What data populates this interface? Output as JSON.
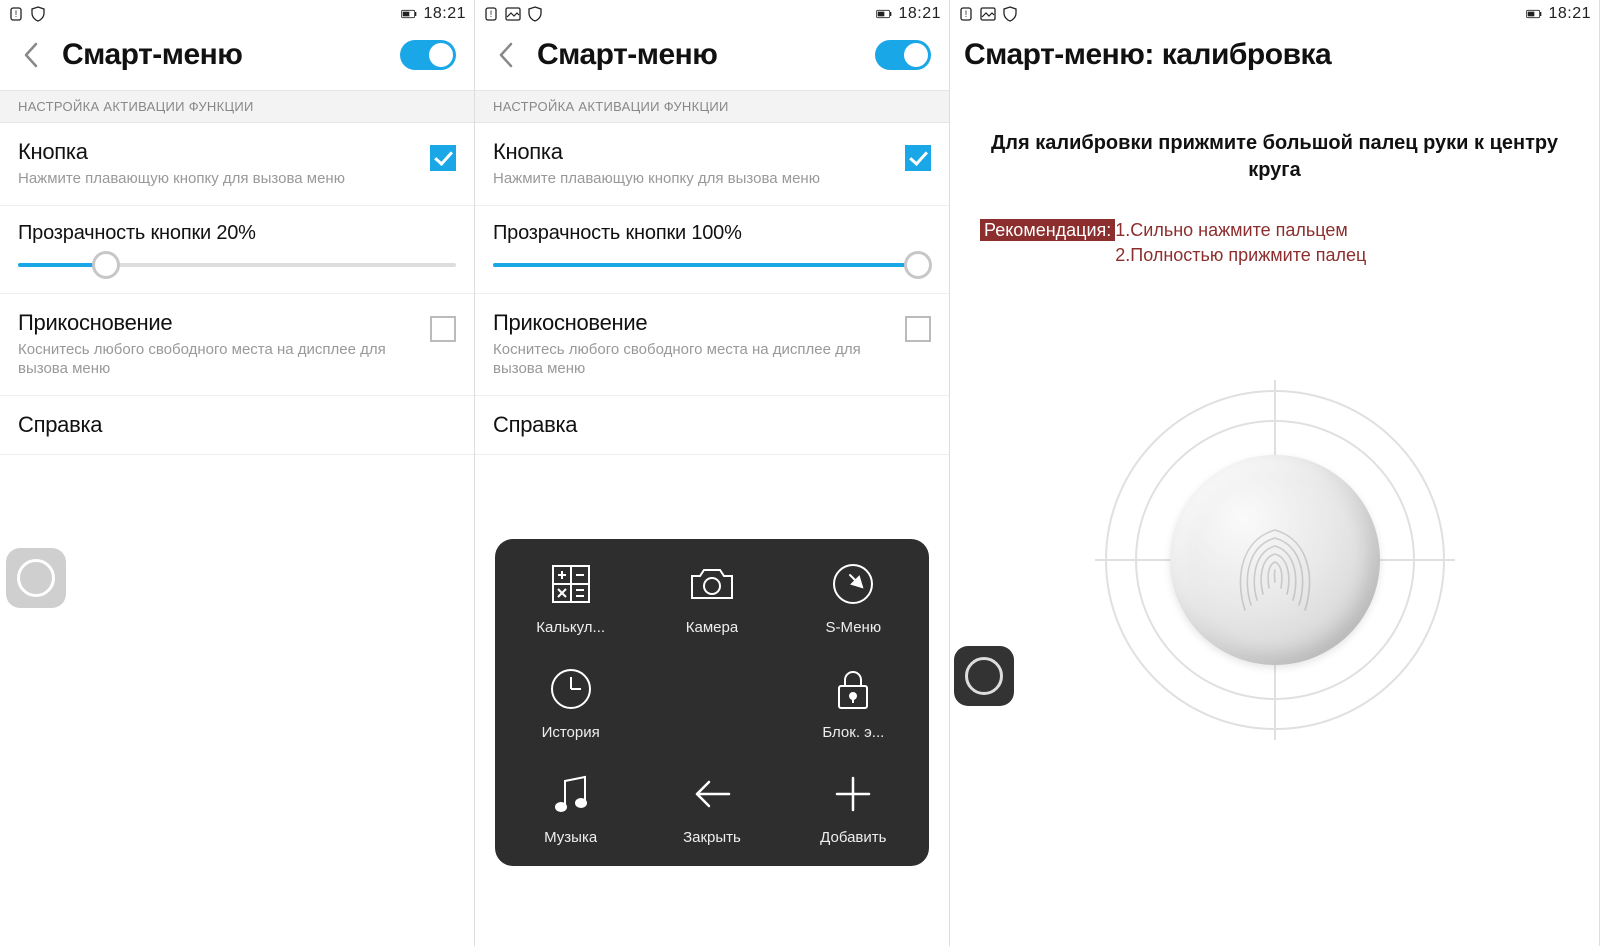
{
  "status": {
    "time": "18:21"
  },
  "screen1": {
    "title": "Смарт-меню",
    "section_label": "НАСТРОЙКА АКТИВАЦИИ ФУНКЦИИ",
    "button_row": {
      "title": "Кнопка",
      "sub": "Нажмите плавающую кнопку для вызова меню"
    },
    "slider": {
      "label_prefix": "Прозрачность кнопки  ",
      "percent": "20%",
      "value": 20
    },
    "touch_row": {
      "title": "Прикосновение",
      "sub": "Коснитесь любого свободного места на дисплее для вызова меню"
    },
    "help_row": {
      "title": "Справка"
    }
  },
  "screen2": {
    "title": "Смарт-меню",
    "section_label": "НАСТРОЙКА АКТИВАЦИИ ФУНКЦИИ",
    "button_row": {
      "title": "Кнопка",
      "sub": "Нажмите плавающую кнопку для вызова меню"
    },
    "slider": {
      "label_prefix": "Прозрачность кнопки  ",
      "percent": "100%",
      "value": 100
    },
    "touch_row": {
      "title": "Прикосновение",
      "sub": "Коснитесь любого свободного места на дисплее для вызова меню"
    },
    "help_row": {
      "title": "Справка"
    },
    "panel": {
      "items": [
        {
          "name": "calculator",
          "label": "Калькул..."
        },
        {
          "name": "camera",
          "label": "Камера"
        },
        {
          "name": "smenu",
          "label": "S-Меню"
        },
        {
          "name": "history",
          "label": "История"
        },
        {
          "name": "empty",
          "label": ""
        },
        {
          "name": "lock",
          "label": "Блок. э..."
        },
        {
          "name": "music",
          "label": "Музыка"
        },
        {
          "name": "close",
          "label": "Закрыть"
        },
        {
          "name": "add",
          "label": "Добавить"
        }
      ]
    }
  },
  "screen3": {
    "title": "Смарт-меню: калибровка",
    "instruction": "Для калибровки прижмите большой палец руки к центру круга",
    "rec_tag": "Рекомендация:",
    "rec1": "1.Сильно нажмите пальцем",
    "rec2": "2.Полностью прижмите палец"
  }
}
